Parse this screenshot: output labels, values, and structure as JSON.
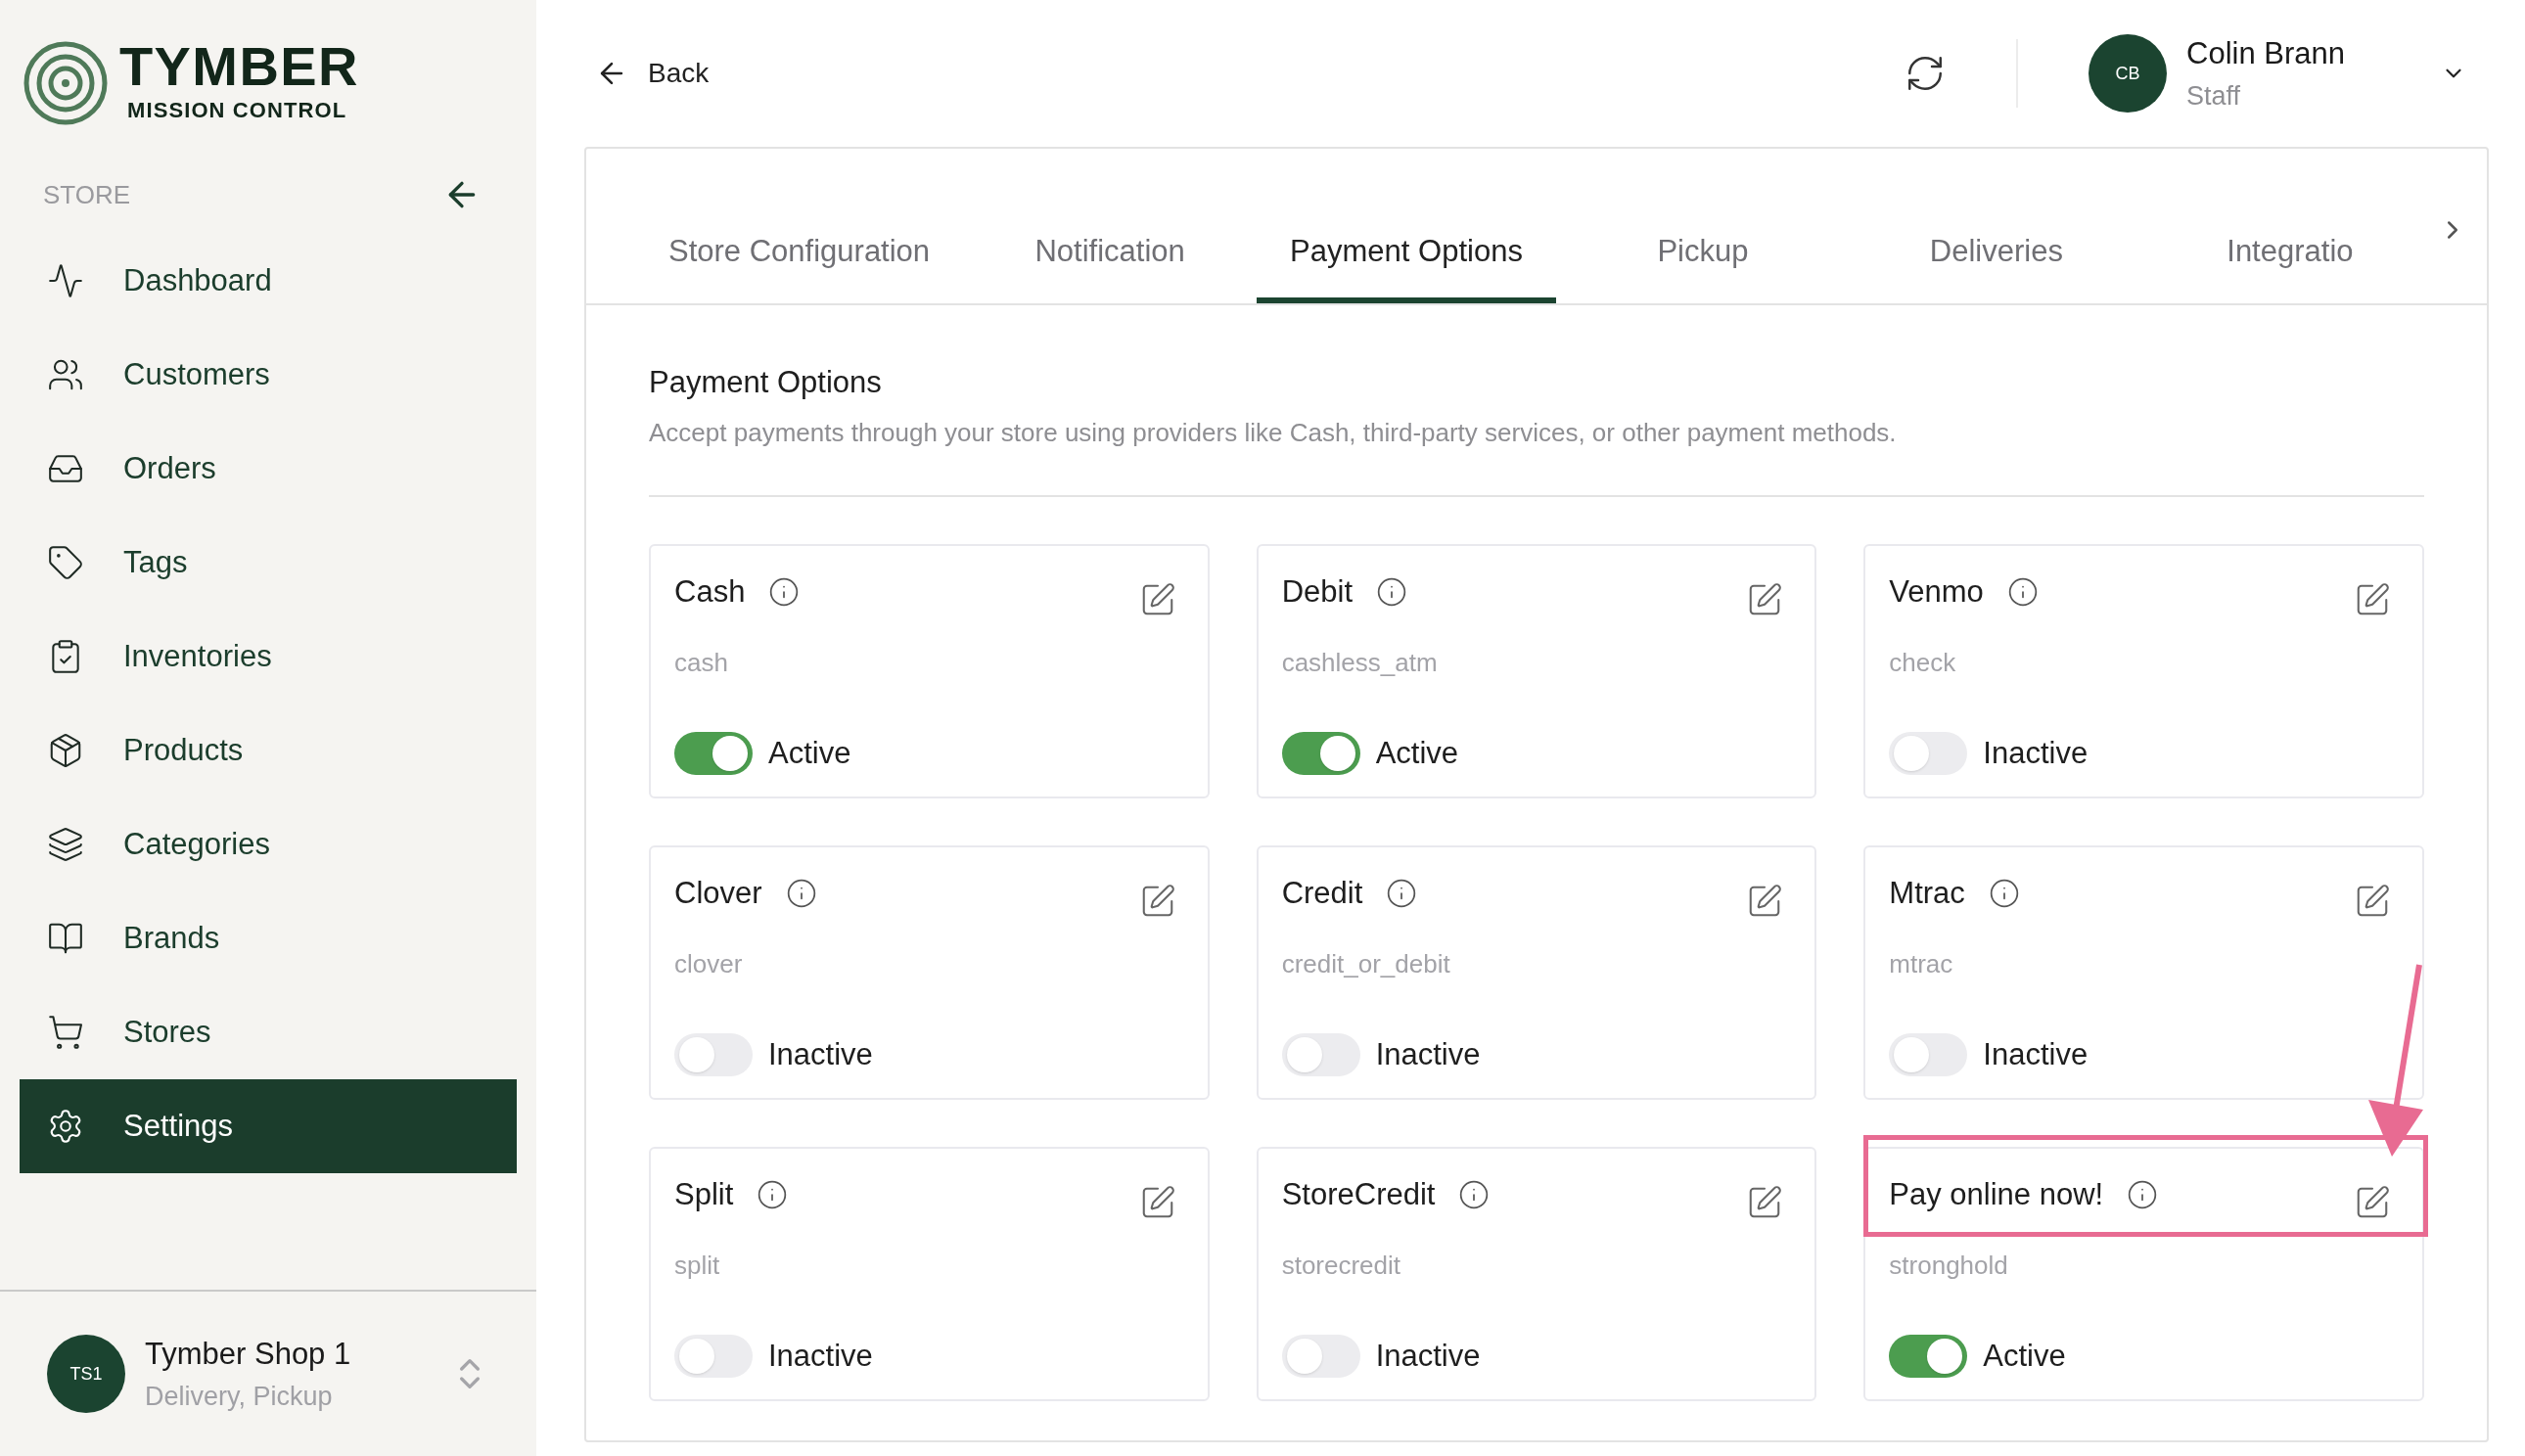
{
  "logo": {
    "name": "TYMBER",
    "subtitle": "MISSION CONTROL"
  },
  "sidebar": {
    "section": "STORE",
    "items": [
      {
        "label": "Dashboard",
        "selected": false
      },
      {
        "label": "Customers",
        "selected": false
      },
      {
        "label": "Orders",
        "selected": false
      },
      {
        "label": "Tags",
        "selected": false
      },
      {
        "label": "Inventories",
        "selected": false
      },
      {
        "label": "Products",
        "selected": false
      },
      {
        "label": "Categories",
        "selected": false
      },
      {
        "label": "Brands",
        "selected": false
      },
      {
        "label": "Stores",
        "selected": false
      },
      {
        "label": "Settings",
        "selected": true
      }
    ],
    "store": {
      "initials": "TS1",
      "name": "Tymber Shop 1",
      "modes": "Delivery, Pickup"
    }
  },
  "header": {
    "back": "Back",
    "user": {
      "initials": "CB",
      "name": "Colin Brann",
      "role": "Staff"
    }
  },
  "tabs": [
    {
      "label": "Store Configuration",
      "selected": false
    },
    {
      "label": "Notification",
      "selected": false
    },
    {
      "label": "Payment Options",
      "selected": true
    },
    {
      "label": "Pickup",
      "selected": false
    },
    {
      "label": "Deliveries",
      "selected": false
    },
    {
      "label": "Integratio",
      "selected": false
    }
  ],
  "section": {
    "title": "Payment Options",
    "description": "Accept payments through your store using providers like Cash, third-party services, or other payment methods."
  },
  "payment_options": [
    {
      "name": "Cash",
      "code": "cash",
      "on": true,
      "status": "Active",
      "highlighted": false
    },
    {
      "name": "Debit",
      "code": "cashless_atm",
      "on": true,
      "status": "Active",
      "highlighted": false
    },
    {
      "name": "Venmo",
      "code": "check",
      "on": false,
      "status": "Inactive",
      "highlighted": false
    },
    {
      "name": "Clover",
      "code": "clover",
      "on": false,
      "status": "Inactive",
      "highlighted": false
    },
    {
      "name": "Credit",
      "code": "credit_or_debit",
      "on": false,
      "status": "Inactive",
      "highlighted": false
    },
    {
      "name": "Mtrac",
      "code": "mtrac",
      "on": false,
      "status": "Inactive",
      "highlighted": false
    },
    {
      "name": "Split",
      "code": "split",
      "on": false,
      "status": "Inactive",
      "highlighted": false
    },
    {
      "name": "StoreCredit",
      "code": "storecredit",
      "on": false,
      "status": "Inactive",
      "highlighted": false
    },
    {
      "name": "Pay online now!",
      "code": "stronghold",
      "on": true,
      "status": "Active",
      "highlighted": true
    }
  ]
}
